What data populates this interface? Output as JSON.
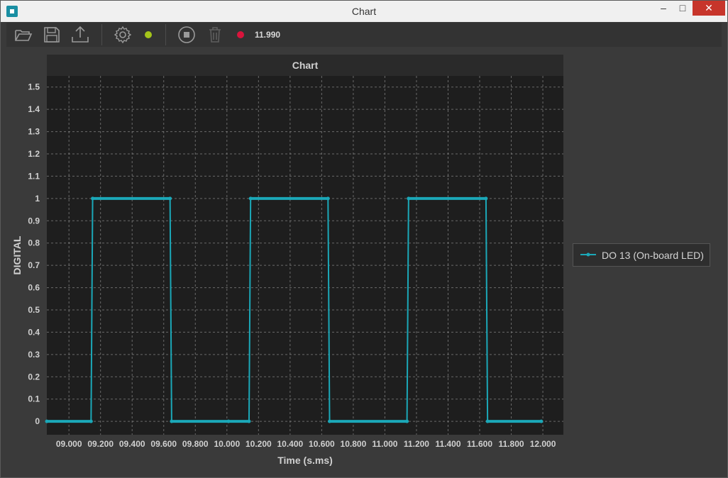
{
  "window": {
    "title": "Chart",
    "min_label": "–",
    "max_label": "□",
    "close_label": "✕"
  },
  "toolbar": {
    "icons": [
      "open-folder-icon",
      "save-icon",
      "export-icon",
      "settings-icon",
      "connection-status-indicator",
      "stop-icon",
      "trash-icon",
      "record-indicator"
    ],
    "status_color": "#a4c41a",
    "record_color": "#d9143c",
    "time_value": "11.990"
  },
  "colors": {
    "series": "#1ba8b8",
    "plot_bg": "#1e1e1e",
    "chart_bg": "#2a2a2a",
    "grid": "#8a8a8a",
    "text": "#d0d0d0"
  },
  "chart_data": {
    "type": "line",
    "title": "Chart",
    "xlabel": "Time (s.ms)",
    "ylabel": "DIGITAL",
    "xlim": [
      8.86,
      12.13
    ],
    "ylim": [
      -0.06,
      1.55
    ],
    "x_ticks": [
      "09.000",
      "09.200",
      "09.400",
      "09.600",
      "09.800",
      "10.000",
      "10.200",
      "10.400",
      "10.600",
      "10.800",
      "11.000",
      "11.200",
      "11.400",
      "11.600",
      "11.800",
      "12.000"
    ],
    "y_ticks": [
      "0",
      "0.1",
      "0.2",
      "0.3",
      "0.4",
      "0.5",
      "0.6",
      "0.7",
      "0.8",
      "0.9",
      "1",
      "1.1",
      "1.2",
      "1.3",
      "1.4",
      "1.5"
    ],
    "legend_position": "right",
    "grid": true,
    "series": [
      {
        "name": "DO 13 (On-board LED)",
        "x": [
          8.86,
          9.14,
          9.15,
          9.64,
          9.65,
          10.01,
          10.14,
          10.15,
          10.64,
          10.65,
          11.14,
          11.15,
          11.64,
          11.65,
          11.99
        ],
        "y": [
          0,
          0,
          1,
          1,
          0,
          0,
          0,
          1,
          1,
          0,
          0,
          1,
          1,
          0,
          0
        ]
      }
    ]
  }
}
